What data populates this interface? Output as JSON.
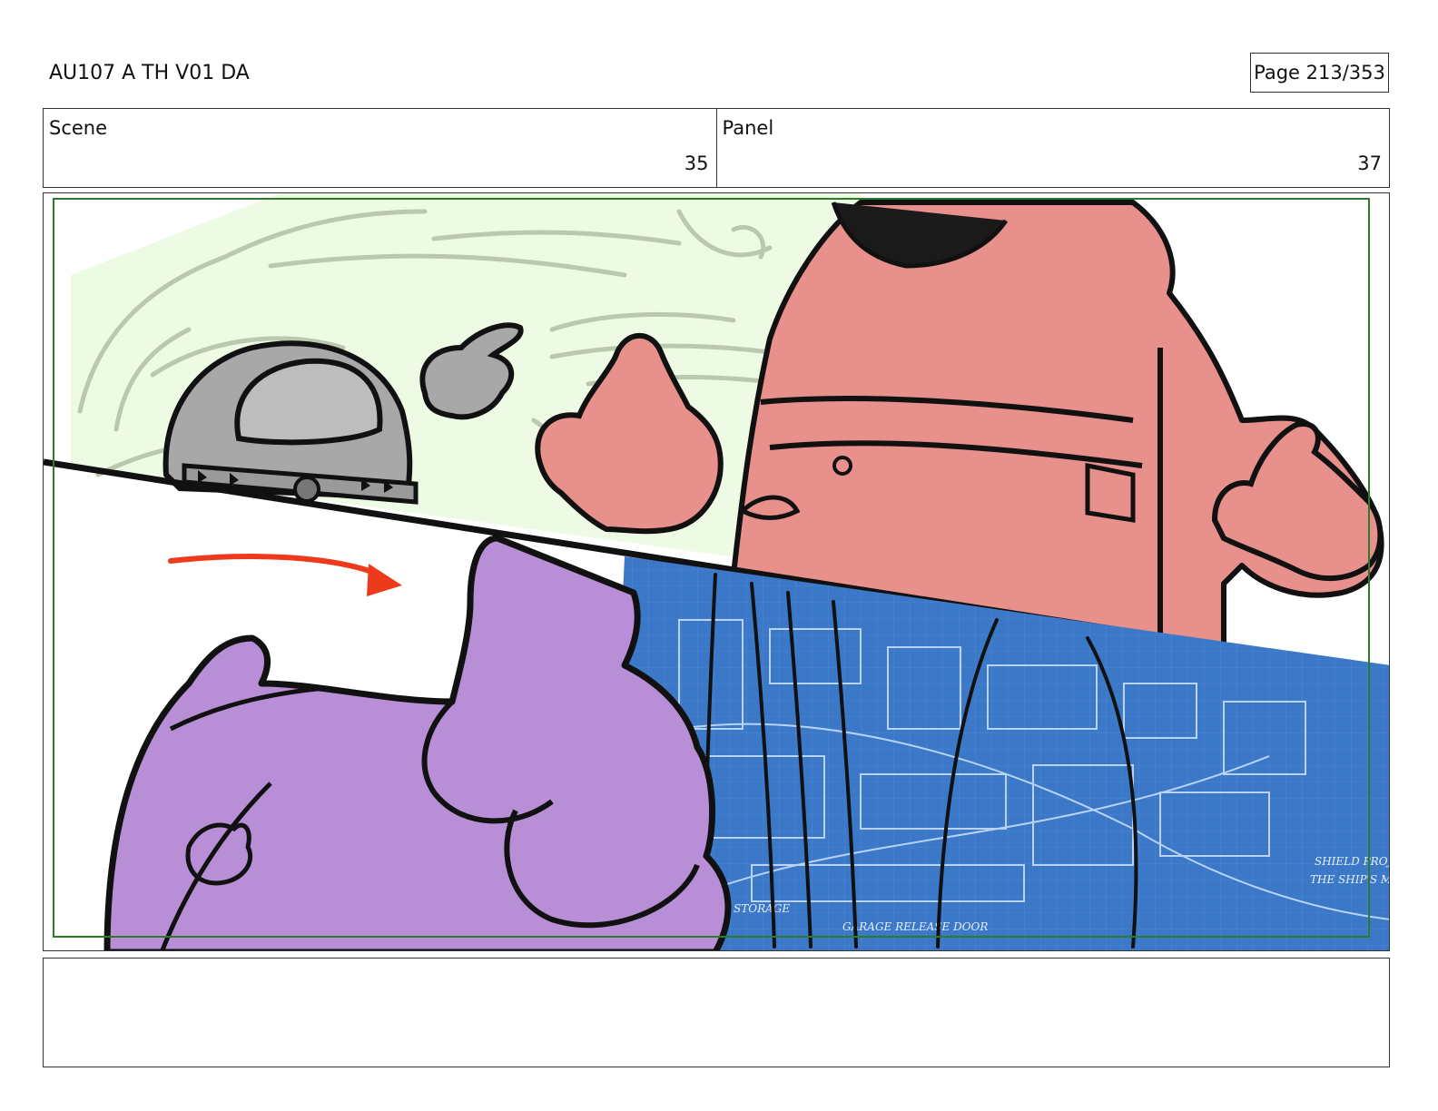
{
  "header": {
    "title": "AU107 A TH V01 DA",
    "page": "Page 213/353"
  },
  "info": {
    "scene_label": "Scene",
    "scene_value": "35",
    "panel_label": "Panel",
    "panel_value": "37"
  },
  "artwork": {
    "description_colors": {
      "sketch_bg": "#eefbe4",
      "pink_character": "#e8908b",
      "purple_character": "#b88fd6",
      "blueprint": "#3b78c8",
      "arrow": "#ee3a1c",
      "helmet": "#a6a6a6",
      "safe_frame": "#2d7a2d"
    },
    "blueprint_text": [
      "SHIELD PROJECTOR",
      "THE SHIP'S MAIN DEFENSE",
      "STORAGE",
      "GARAGE RELEASE DOOR"
    ]
  },
  "notes": {
    "text": ""
  }
}
